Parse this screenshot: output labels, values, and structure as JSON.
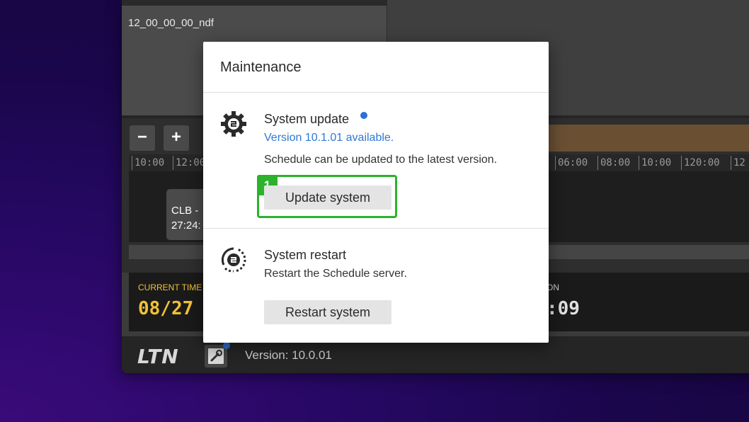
{
  "app": {
    "file_name": "12_00_00_00_ndf",
    "zoom_out_label": "−",
    "zoom_in_label": "+",
    "ruler_ticks_left": [
      "10:00",
      "12:00"
    ],
    "ruler_ticks_right": [
      "06:00",
      "08:00",
      "10:00",
      "120:00",
      "12"
    ],
    "clip_line1": "CLB -",
    "clip_line2": "27:24:",
    "current_time_label": "CURRENT TIME",
    "current_time_value": "08/27",
    "duration_label": "ON",
    "duration_value": ":09",
    "logo": "LTN",
    "version": "Version: 10.0.01"
  },
  "dialog": {
    "title": "Maintenance",
    "update": {
      "title": "System update",
      "available": "Version 10.1.01 available.",
      "description": "Schedule can be updated to the latest version.",
      "badge": "1",
      "button": "Update system"
    },
    "restart": {
      "title": "System restart",
      "description": "Restart the Schedule server.",
      "button": "Restart system"
    }
  },
  "colors": {
    "accent_blue": "#2c6fd6",
    "highlight_green": "#2bb32b",
    "status_yellow": "#f2c235"
  },
  "icons": {
    "update": "gear-update-icon",
    "restart": "restart-icon",
    "maintenance": "wrench-icon"
  }
}
